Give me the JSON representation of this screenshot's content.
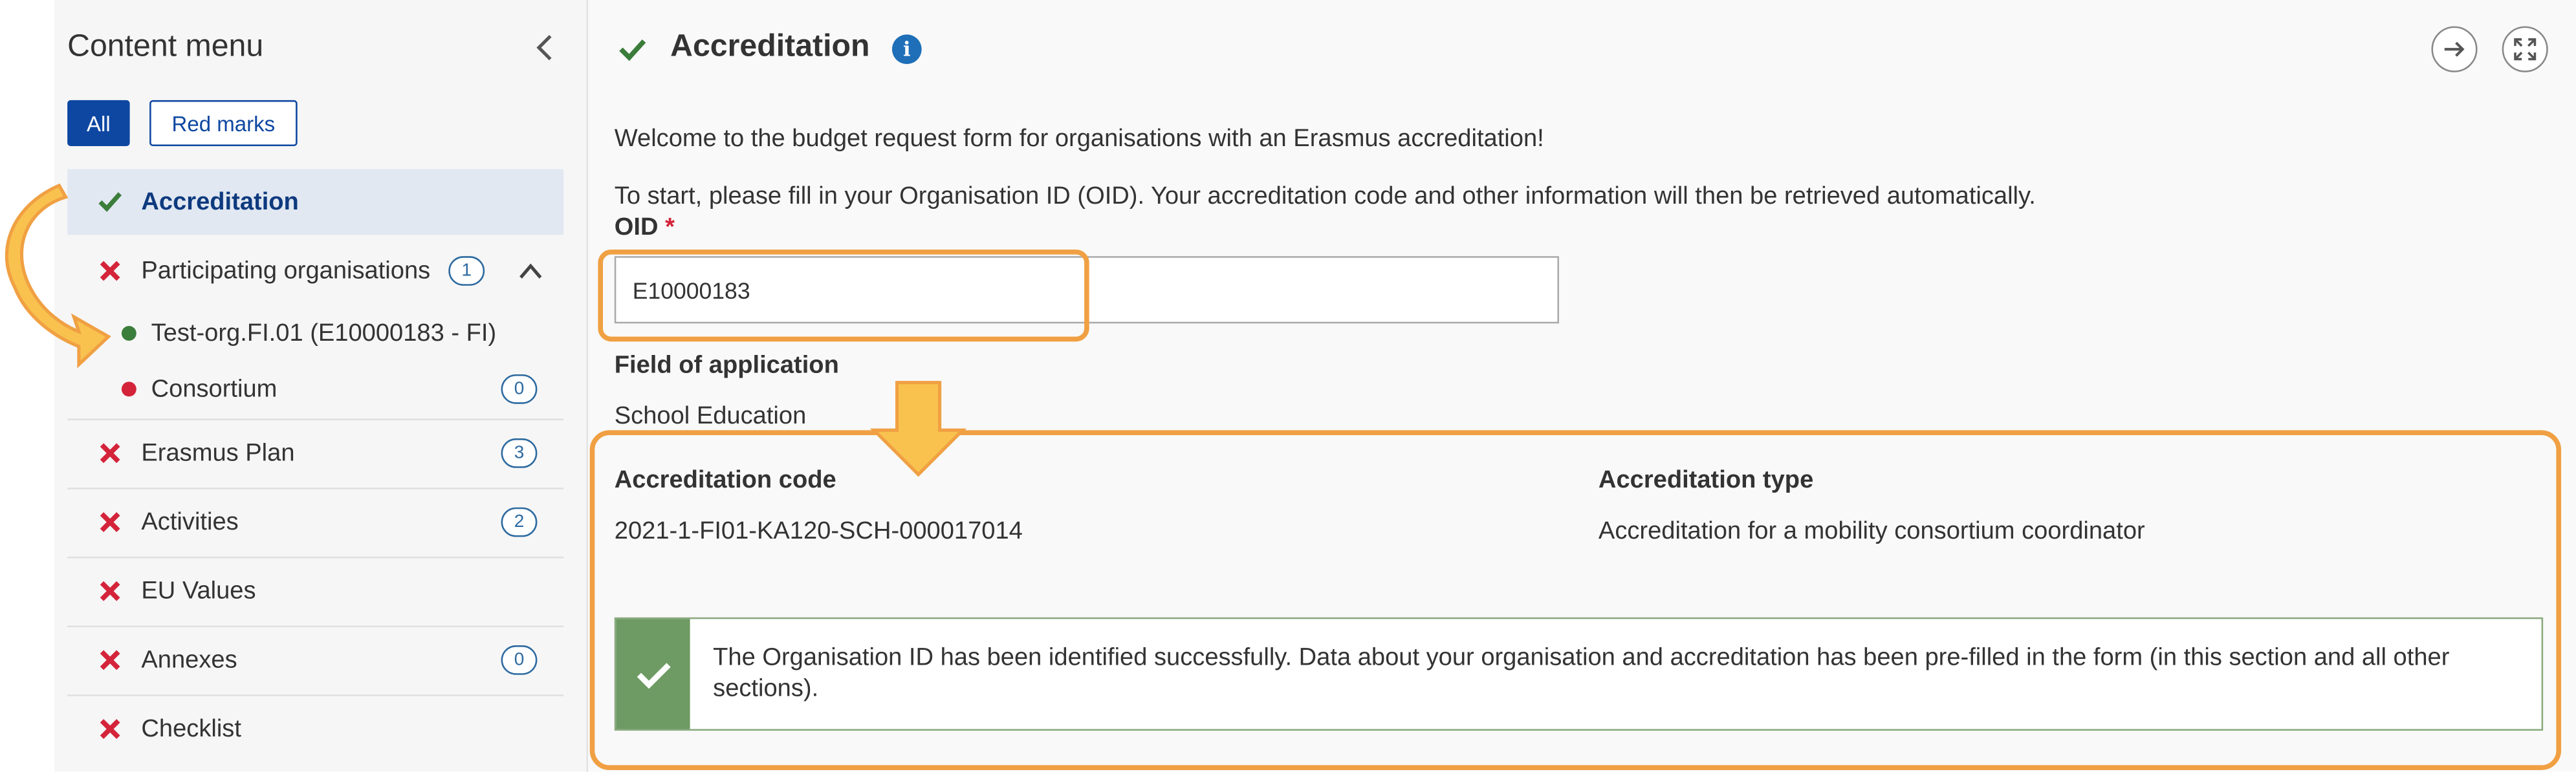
{
  "sidebar": {
    "title": "Content menu",
    "filters": {
      "all": "All",
      "red_marks": "Red marks"
    },
    "items": [
      {
        "label": "Accreditation",
        "status": "check"
      },
      {
        "label": "Participating organisations",
        "status": "cross",
        "badge": "1"
      },
      {
        "label": "Test-org.FI.01 (E10000183 - FI)",
        "status": "green-dot"
      },
      {
        "label": "Consortium",
        "status": "red-dot",
        "badge": "0"
      },
      {
        "label": "Erasmus Plan",
        "status": "cross",
        "badge": "3"
      },
      {
        "label": "Activities",
        "status": "cross",
        "badge": "2"
      },
      {
        "label": "EU Values",
        "status": "cross"
      },
      {
        "label": "Annexes",
        "status": "cross",
        "badge": "0"
      },
      {
        "label": "Checklist",
        "status": "cross"
      }
    ]
  },
  "main": {
    "title": "Accreditation",
    "intro": "Welcome to the budget request form for organisations with an Erasmus accreditation!",
    "instruction": "To start, please fill in your Organisation ID (OID). Your accreditation code and other information will then be retrieved automatically.",
    "oid": {
      "label": "OID",
      "required": "*",
      "value": "E10000183"
    },
    "field_of_application": {
      "label": "Field of application",
      "value": "School Education"
    },
    "accreditation_code": {
      "label": "Accreditation code",
      "value": "2021-1-FI01-KA120-SCH-000017014"
    },
    "accreditation_type": {
      "label": "Accreditation type",
      "value": "Accreditation for a mobility consortium coordinator"
    },
    "success_message": "The Organisation ID has been identified successfully. Data about your organisation and accreditation has been pre-filled in the form (in this section and all other sections)."
  },
  "icons": {
    "check": "check-icon",
    "cross": "cross-icon",
    "info": "info-icon",
    "next": "arrow-right-icon",
    "fullscreen": "expand-icon",
    "collapse": "chevron-left-icon"
  },
  "colors": {
    "brand": "#0e47a1",
    "success": "#3b7d3b",
    "error": "#d4243a",
    "highlight": "#f0a043"
  }
}
